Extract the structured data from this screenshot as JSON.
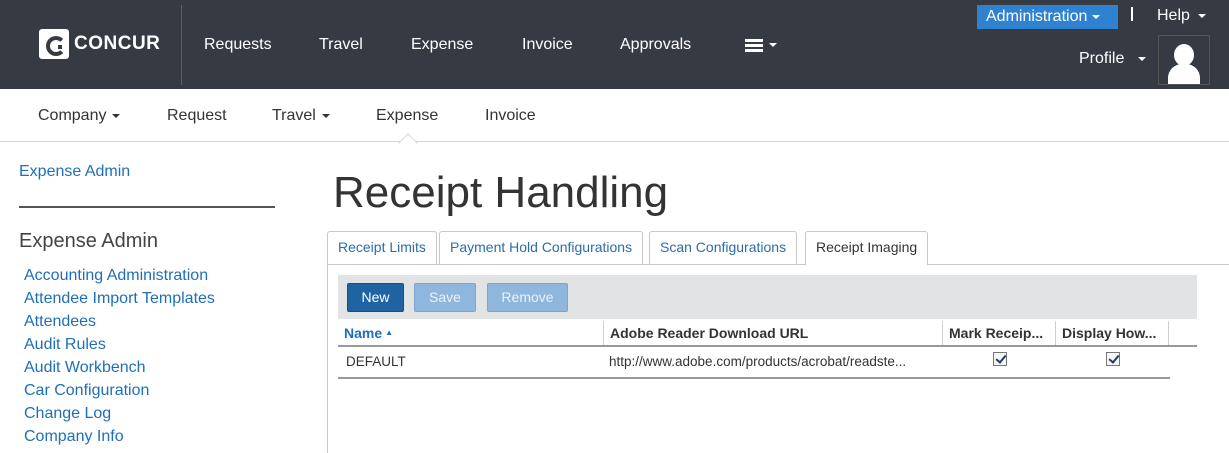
{
  "brand": {
    "logo_text": "CONCUR"
  },
  "topnav": {
    "items": [
      "Requests",
      "Travel",
      "Expense",
      "Invoice",
      "Approvals"
    ],
    "menu_icon": "hamburger-icon",
    "administration_label": "Administration",
    "help_label": "Help",
    "profile_label": "Profile"
  },
  "subnav": {
    "items": [
      "Company",
      "Request",
      "Travel",
      "Expense",
      "Invoice"
    ],
    "active": "Expense"
  },
  "sidebar": {
    "top_link": "Expense Admin",
    "heading": "Expense Admin",
    "links": [
      "Accounting Administration",
      "Attendee Import Templates",
      "Attendees",
      "Audit Rules",
      "Audit Workbench",
      "Car Configuration",
      "Change Log",
      "Company Info"
    ]
  },
  "main": {
    "title": "Receipt Handling",
    "tabs": [
      "Receipt Limits",
      "Payment Hold Configurations",
      "Scan Configurations",
      "Receipt Imaging"
    ],
    "active_tab": "Receipt Imaging",
    "toolbar": {
      "new_label": "New",
      "save_label": "Save",
      "remove_label": "Remove"
    },
    "grid": {
      "columns": [
        "Name",
        "Adobe Reader Download URL",
        "Mark Receip...",
        "Display How..."
      ],
      "sorted_column": "Name",
      "rows": [
        {
          "name": "DEFAULT",
          "url": "http://www.adobe.com/products/acrobat/readste...",
          "mark_receipt": true,
          "display_how": true
        }
      ]
    }
  },
  "colors": {
    "topbar": "#363b43",
    "accent": "#2f82cf",
    "link": "#1e6fb8",
    "primary_button": "#1f63a3"
  }
}
